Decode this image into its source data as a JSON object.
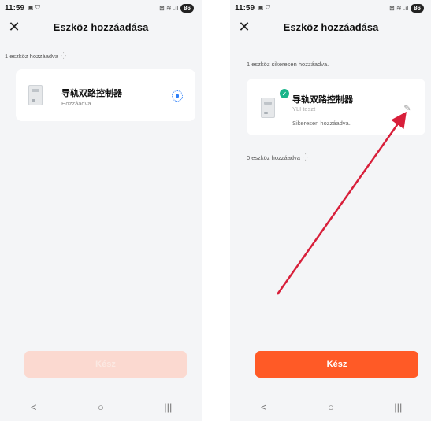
{
  "status": {
    "time": "11:59",
    "left_icons": "▣ ⛉",
    "right_icons": "⊠ ≋ .ıl",
    "battery": "86"
  },
  "header": {
    "title": "Eszköz hozzáadása"
  },
  "left": {
    "section_label": "1 eszköz hozzáadva",
    "device_name": "导轨双路控制器",
    "device_status": "Hozzáadva",
    "done_label": "Kész"
  },
  "right": {
    "success_label": "1 eszköz sikeresen hozzáadva.",
    "device_name": "导轨双路控制器",
    "device_room": "YLI teszt",
    "device_result": "Sikeresen hozzáadva.",
    "pending_label": "0 eszköz hozzáadva",
    "done_label": "Kész"
  },
  "nav": {
    "back": "<",
    "home": "○",
    "recents": "|||"
  },
  "colors": {
    "accent": "#ff5a26",
    "accent_disabled": "#fbd9d0",
    "success": "#19b58a",
    "progress": "#2d7ff9",
    "annotation_arrow": "#d81f3a"
  },
  "icons": {
    "close": "close-icon",
    "check": "check-icon",
    "edit": "pencil-icon",
    "loading": "spinner-icon",
    "progress": "progress-icon"
  }
}
